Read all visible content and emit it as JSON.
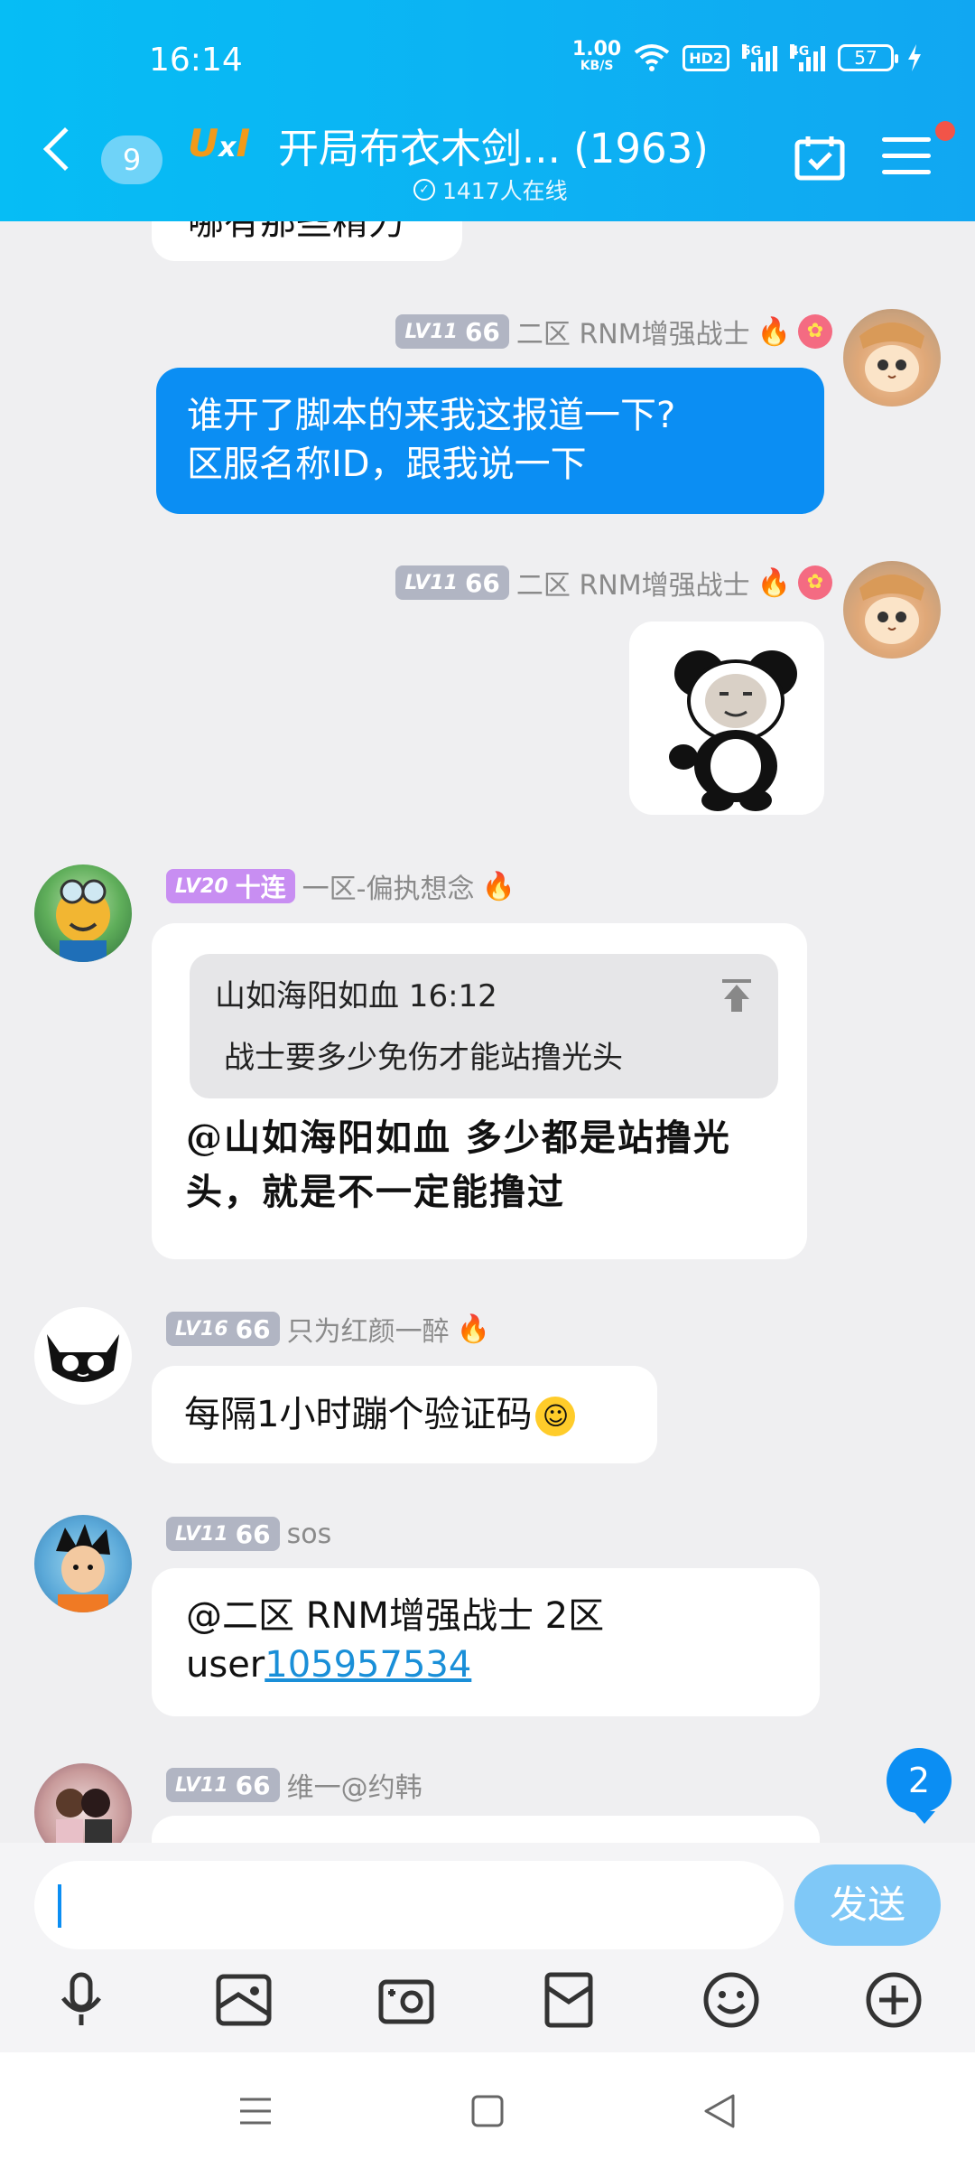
{
  "status_bar": {
    "time": "16:14",
    "net_speed_value": "1.00",
    "net_speed_unit": "KB/S",
    "hd_label": "HD2",
    "sig1_label": "5G",
    "sig2_label": "4G",
    "battery": "57"
  },
  "header": {
    "unread_count": "9",
    "logo_u": "U",
    "logo_x": "x",
    "logo_i": "I",
    "title": "开局布衣木剑...  (1963)",
    "online_text": "1417人在线",
    "icons": [
      "back-arrow-icon",
      "calendar-check-icon",
      "menu-icon"
    ]
  },
  "messages": [
    {
      "side": "right",
      "level": "LV11",
      "level_tag": "66",
      "sender": "二区 RNM增强战士",
      "text_line1": "谁开了脚本的来我这报道一下?",
      "text_line2": "区服名称ID，跟我说一下"
    },
    {
      "side": "right",
      "level": "LV11",
      "level_tag": "66",
      "sender": "二区 RNM增强战士",
      "image": "panda-meme-sticker"
    },
    {
      "side": "left",
      "level": "LV20",
      "level_tag": "十连",
      "sender": "一区-偏执想念",
      "quote_author_time": "山如海阳如血 16:12",
      "quote_text": "战士要多少免伤才能站撸光头",
      "text_line1": "@山如海阳如血 多少都是站撸光",
      "text_line2": "头，就是不一定能撸过"
    },
    {
      "side": "left",
      "level": "LV16",
      "level_tag": "66",
      "sender": "只为红颜一醉",
      "text": "每隔1小时蹦个验证码"
    },
    {
      "side": "left",
      "level": "LV11",
      "level_tag": "66",
      "sender": "sos",
      "text_line1": "@二区 RNM增强战士 2区",
      "text_line2_prefix": "user",
      "text_line2_link": "105957534"
    },
    {
      "side": "left",
      "level": "LV11",
      "level_tag": "66",
      "sender": "维一@约韩"
    }
  ],
  "top_partial_text": "哪有那些精力",
  "new_message_badge": "2",
  "composer": {
    "send_label": "发送",
    "tools": [
      "microphone-icon",
      "image-icon",
      "camera-icon",
      "red-packet-icon",
      "emoji-icon",
      "plus-icon"
    ]
  },
  "colors": {
    "header": "#0cb3f3",
    "self_bubble": "#0b8ef3",
    "send_button": "#7fc8f7",
    "badge_red": "#f25448"
  }
}
